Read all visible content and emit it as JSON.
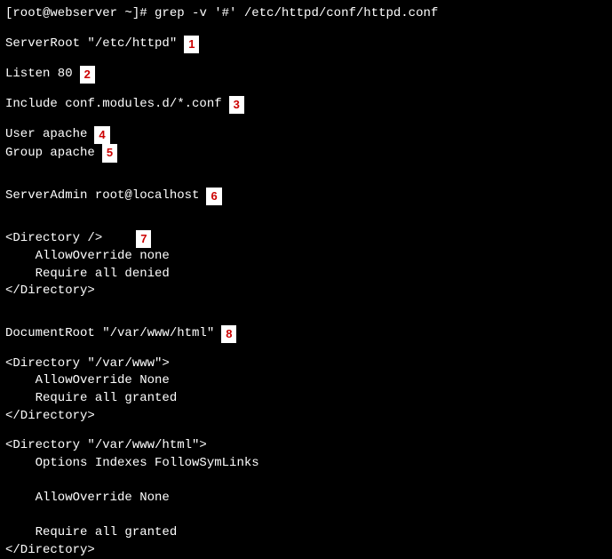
{
  "prompt": "[root@webserver ~]# ",
  "command": "grep -v '#' /etc/httpd/conf/httpd.conf",
  "lines": {
    "serverRoot": "ServerRoot \"/etc/httpd\"",
    "listen": "Listen 80",
    "include": "Include conf.modules.d/*.conf",
    "user": "User apache",
    "group": "Group apache",
    "serverAdmin": "ServerAdmin root@localhost",
    "dirRoot0": "<Directory />",
    "dirRoot1": "    AllowOverride none",
    "dirRoot2": "    Require all denied",
    "dirRoot3": "</Directory>",
    "docRoot": "DocumentRoot \"/var/www/html\"",
    "dirVarWww0": "<Directory \"/var/www\">",
    "dirVarWww1": "    AllowOverride None",
    "dirVarWww2": "    Require all granted",
    "dirVarWww3": "</Directory>",
    "dirHtml0": "<Directory \"/var/www/html\">",
    "dirHtml1": "    Options Indexes FollowSymLinks",
    "dirHtml2": "    AllowOverride None",
    "dirHtml3": "    Require all granted",
    "dirHtml4": "</Directory>"
  },
  "annotations": {
    "a1": "1",
    "a2": "2",
    "a3": "3",
    "a4": "4",
    "a5": "5",
    "a6": "6",
    "a7": "7",
    "a8": "8"
  }
}
